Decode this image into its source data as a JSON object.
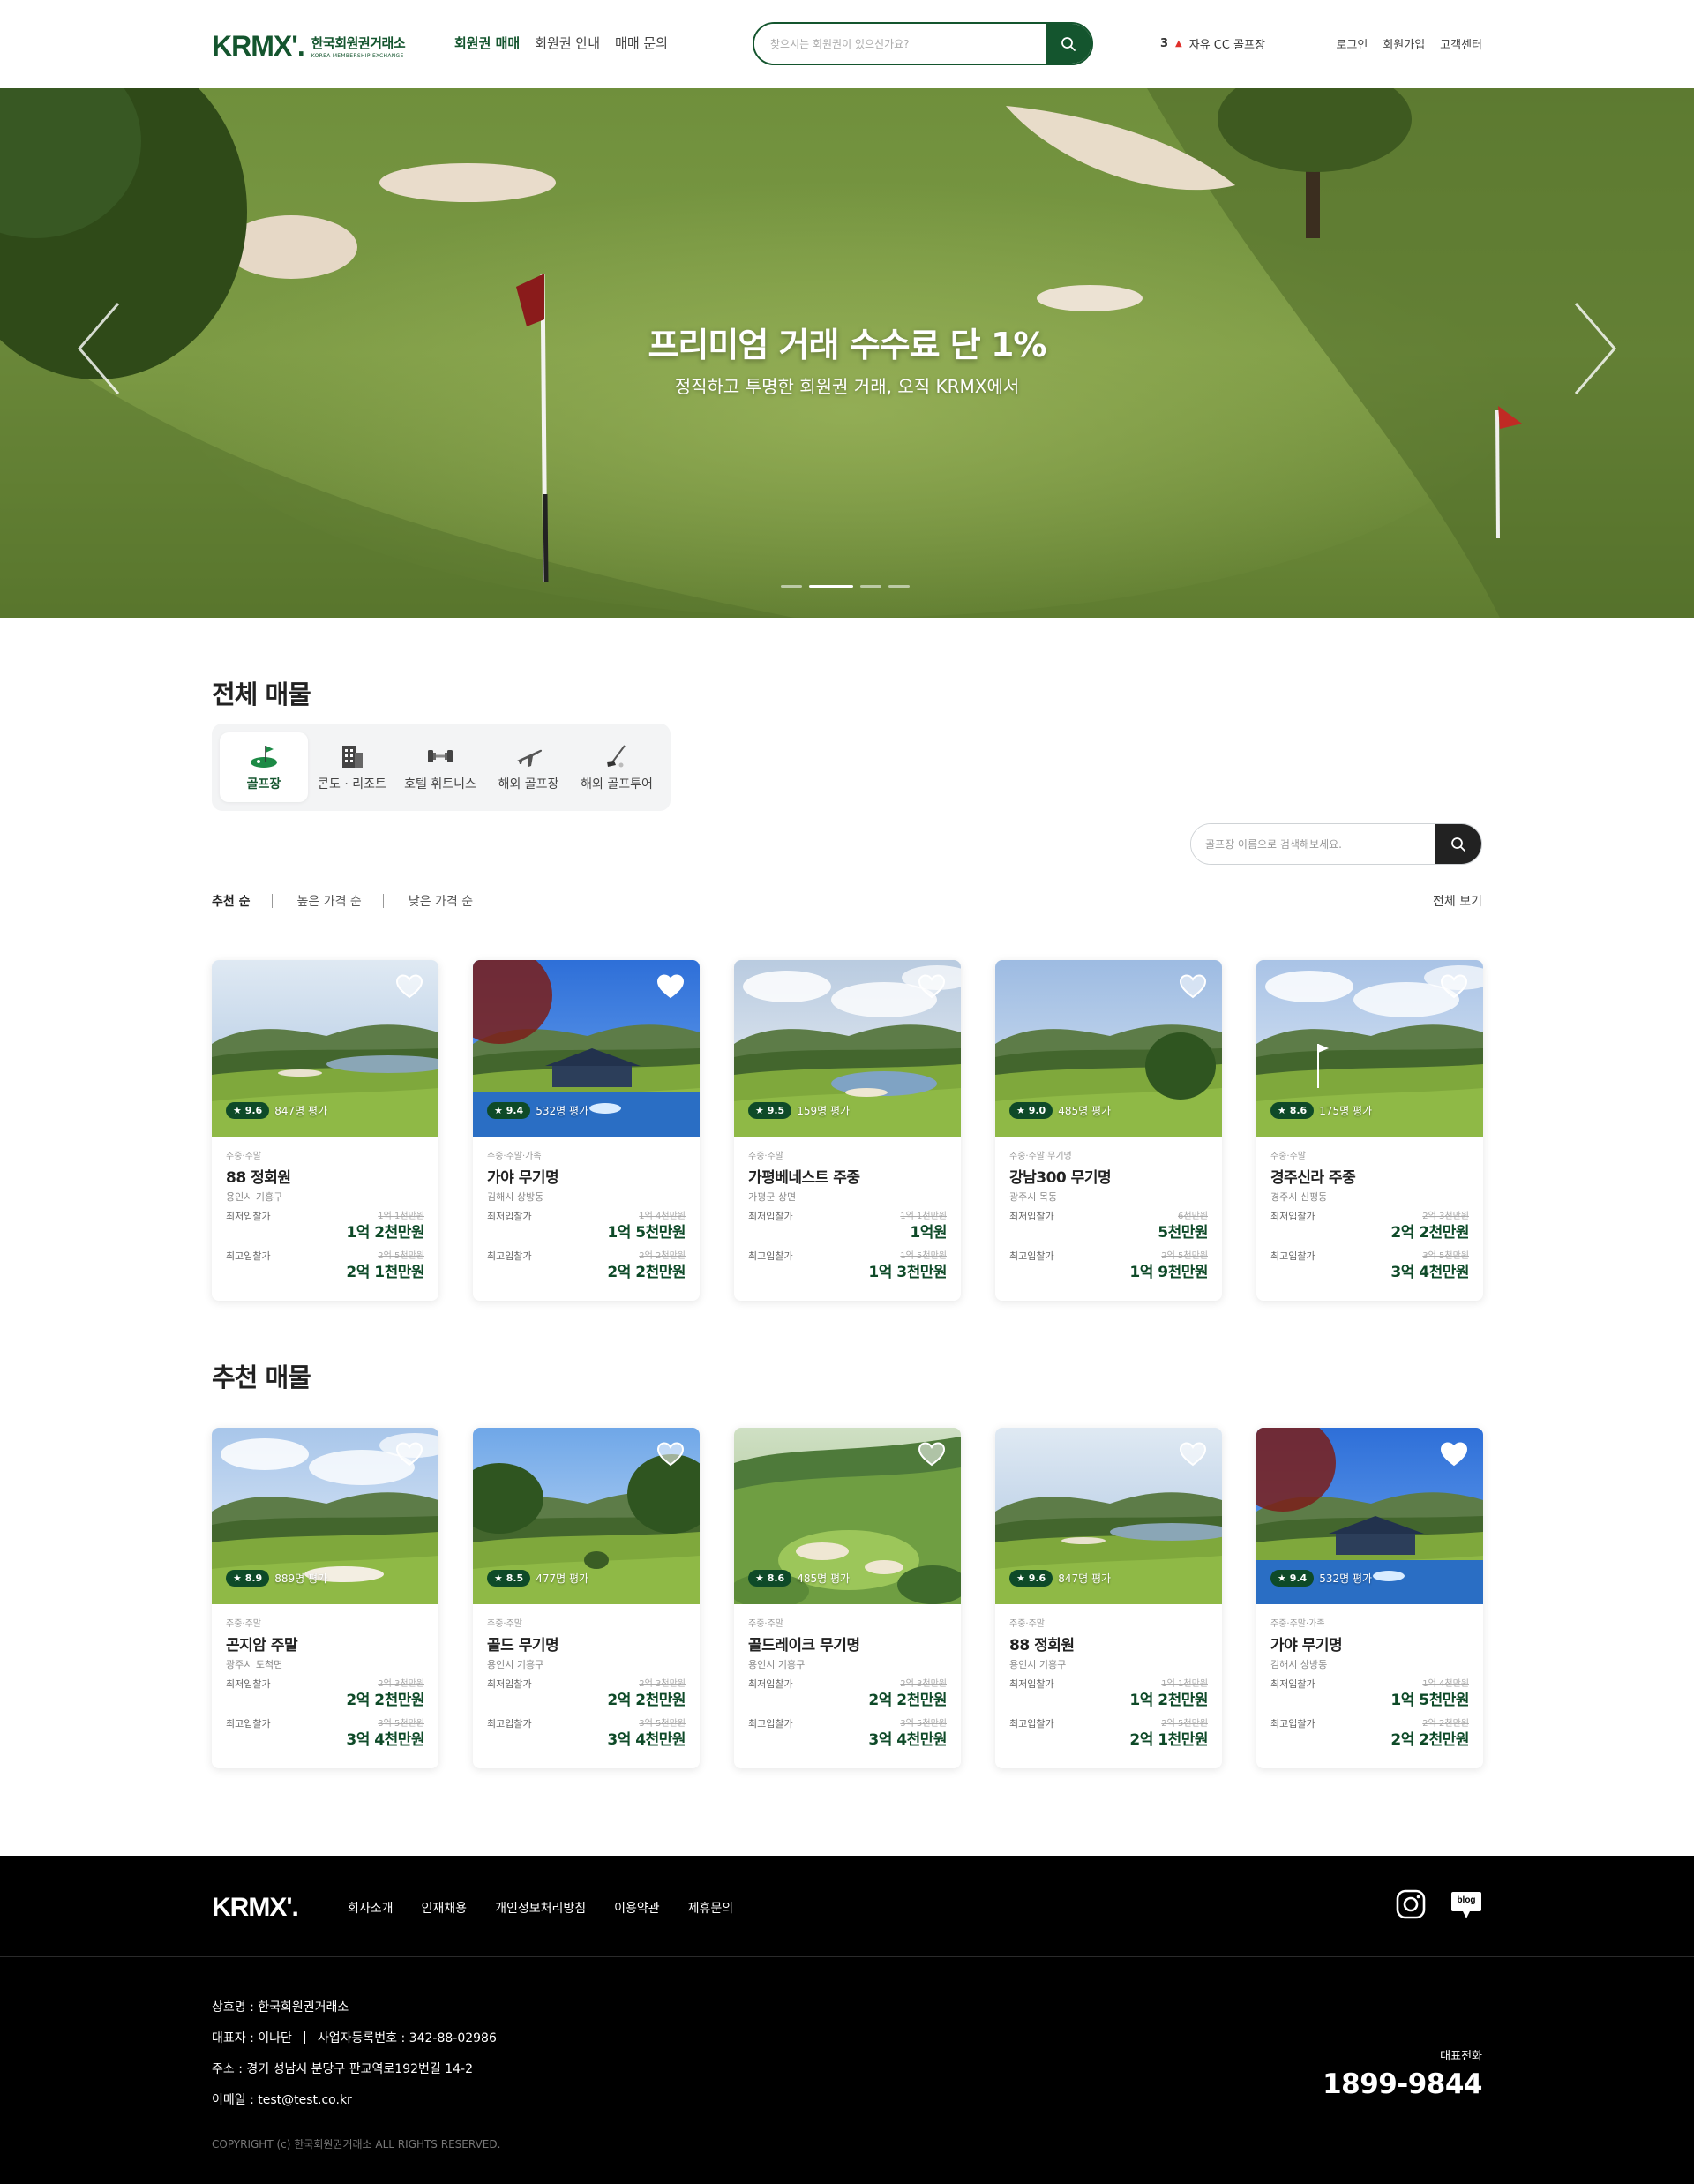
{
  "header": {
    "logo_mark": "KRMX'.",
    "logo_kr": "한국회원권거래소",
    "logo_en": "KOREA MEMBERSHIP EXCHANGE",
    "nav": [
      "회원권 매매",
      "회원권 안내",
      "매매 문의"
    ],
    "search_placeholder": "찾으시는 회원권이 있으신가요?",
    "ranking_num": "3",
    "ranking_text": "자유 CC 골프장",
    "util": [
      "로그인",
      "회원가입",
      "고객센터"
    ]
  },
  "hero": {
    "title": "프리미엄 거래 수수료 단 1%",
    "subtitle": "정직하고 투명한 회원권 거래, 오직 KRMX에서",
    "slide_count": 4,
    "active_slide": 1
  },
  "all_listings": {
    "title": "전체 매물",
    "categories": [
      "골프장",
      "콘도 · 리조트",
      "호텔 휘트니스",
      "해외 골프장",
      "해외 골프투어"
    ],
    "active_category": 0,
    "search_placeholder": "골프장 이름으로 검색해보세요.",
    "sort": [
      "추천 순",
      "높은 가격 순",
      "낮은 가격 순"
    ],
    "view_all": "전체 보기",
    "cards": [
      {
        "score": "9.6",
        "reviews": "847명 평가",
        "tags": "주중·주말",
        "name": "88 정회원",
        "loc": "용인시 기흥구",
        "min_label": "최저입찰가",
        "min_old": "1억 1천만원",
        "min_new": "1억 2천만원",
        "max_label": "최고입찰가",
        "max_old": "2억 5천만원",
        "max_new": "2억 1천만원",
        "scene": "lake",
        "liked": false
      },
      {
        "score": "9.4",
        "reviews": "532명 평가",
        "tags": "주중·주말·가족",
        "name": "가야 무기명",
        "loc": "김해시 상방동",
        "min_label": "최저입찰가",
        "min_old": "1억 4천만원",
        "min_new": "1억 5천만원",
        "max_label": "최고입찰가",
        "max_old": "2억 2천만원",
        "max_new": "2억 2천만원",
        "scene": "clubhouse",
        "liked": true
      },
      {
        "score": "9.5",
        "reviews": "159명 평가",
        "tags": "주중·주말",
        "name": "가평베네스트 주중",
        "loc": "가평군 상면",
        "min_label": "최저입찰가",
        "min_old": "1억 1천만원",
        "min_new": "1억원",
        "max_label": "최고입찰가",
        "max_old": "1억 5천만원",
        "max_new": "1억 3천만원",
        "scene": "cloudy",
        "liked": false
      },
      {
        "score": "9.0",
        "reviews": "485명 평가",
        "tags": "주중·주말·무기명",
        "name": "강남300 무기명",
        "loc": "광주시 목동",
        "min_label": "최저입찰가",
        "min_old": "6천만원",
        "min_new": "5천만원",
        "max_label": "최고입찰가",
        "max_old": "2억 5천만원",
        "max_new": "1억 9천만원",
        "scene": "mountain",
        "liked": false
      },
      {
        "score": "8.6",
        "reviews": "175명 평가",
        "tags": "주중·주말",
        "name": "경주신라 주중",
        "loc": "경주시 신평동",
        "min_label": "최저입찰가",
        "min_old": "2억 3천만원",
        "min_new": "2억 2천만원",
        "max_label": "최고입찰가",
        "max_old": "3억 5천만원",
        "max_new": "3억 4천만원",
        "scene": "flag",
        "liked": false
      }
    ]
  },
  "recommended": {
    "title": "추천 매물",
    "cards": [
      {
        "score": "8.9",
        "reviews": "889명 평가",
        "tags": "주중·주말",
        "name": "곤지암 주말",
        "loc": "광주시 도척면",
        "min_label": "최저입찰가",
        "min_old": "2억 3천만원",
        "min_new": "2억 2천만원",
        "max_label": "최고입찰가",
        "max_old": "3억 5천만원",
        "max_new": "3억 4천만원",
        "scene": "bunker",
        "liked": false
      },
      {
        "score": "8.5",
        "reviews": "477명 평가",
        "tags": "주중·주말",
        "name": "골드 무기명",
        "loc": "용인시 기흥구",
        "min_label": "최저입찰가",
        "min_old": "2억 3천만원",
        "min_new": "2억 2천만원",
        "max_label": "최고입찰가",
        "max_old": "3억 5천만원",
        "max_new": "3억 4천만원",
        "scene": "forest",
        "liked": false
      },
      {
        "score": "8.6",
        "reviews": "485명 평가",
        "tags": "주중·주말",
        "name": "골드레이크 무기명",
        "loc": "용인시 기흥구",
        "min_label": "최저입찰가",
        "min_old": "2억 3천만원",
        "min_new": "2억 2천만원",
        "max_label": "최고입찰가",
        "max_old": "3억 5천만원",
        "max_new": "3억 4천만원",
        "scene": "aerial",
        "liked": false
      },
      {
        "score": "9.6",
        "reviews": "847명 평가",
        "tags": "주중·주말",
        "name": "88 정회원",
        "loc": "용인시 기흥구",
        "min_label": "최저입찰가",
        "min_old": "1억 1천만원",
        "min_new": "1억 2천만원",
        "max_label": "최고입찰가",
        "max_old": "2억 5천만원",
        "max_new": "2억 1천만원",
        "scene": "lake",
        "liked": false
      },
      {
        "score": "9.4",
        "reviews": "532명 평가",
        "tags": "주중·주말·가족",
        "name": "가야 무기명",
        "loc": "김해시 상방동",
        "min_label": "최저입찰가",
        "min_old": "1억 4천만원",
        "min_new": "1억 5천만원",
        "max_label": "최고입찰가",
        "max_old": "2억 2천만원",
        "max_new": "2억 2천만원",
        "scene": "clubhouse",
        "liked": true
      }
    ]
  },
  "footer": {
    "logo": "KRMX'.",
    "nav": [
      "회사소개",
      "인재채용",
      "개인정보처리방침",
      "이용약관",
      "제휴문의"
    ],
    "company": "상호명 : 한국회원권거래소",
    "ceo": "대표자 : 이나단",
    "biz_no": "사업자등록번호 : 342-88-02986",
    "address": "주소 : 경기 성남시 분당구 판교역로192번길 14-2",
    "email": "이메일 : test@test.co.kr",
    "copyright": "COPYRIGHT (c) 한국회원권거래소 ALL RIGHTS RESERVED.",
    "tel_label": "대표전화",
    "tel": "1899-9844",
    "sns": [
      "instagram-icon",
      "blog-icon"
    ],
    "blog_text": "blog"
  },
  "colors": {
    "brand": "#14552e",
    "badge": "#0e4a28",
    "price": "#0e4a28",
    "footer_bg": "#000000",
    "down_arrow": "#e0302b"
  }
}
